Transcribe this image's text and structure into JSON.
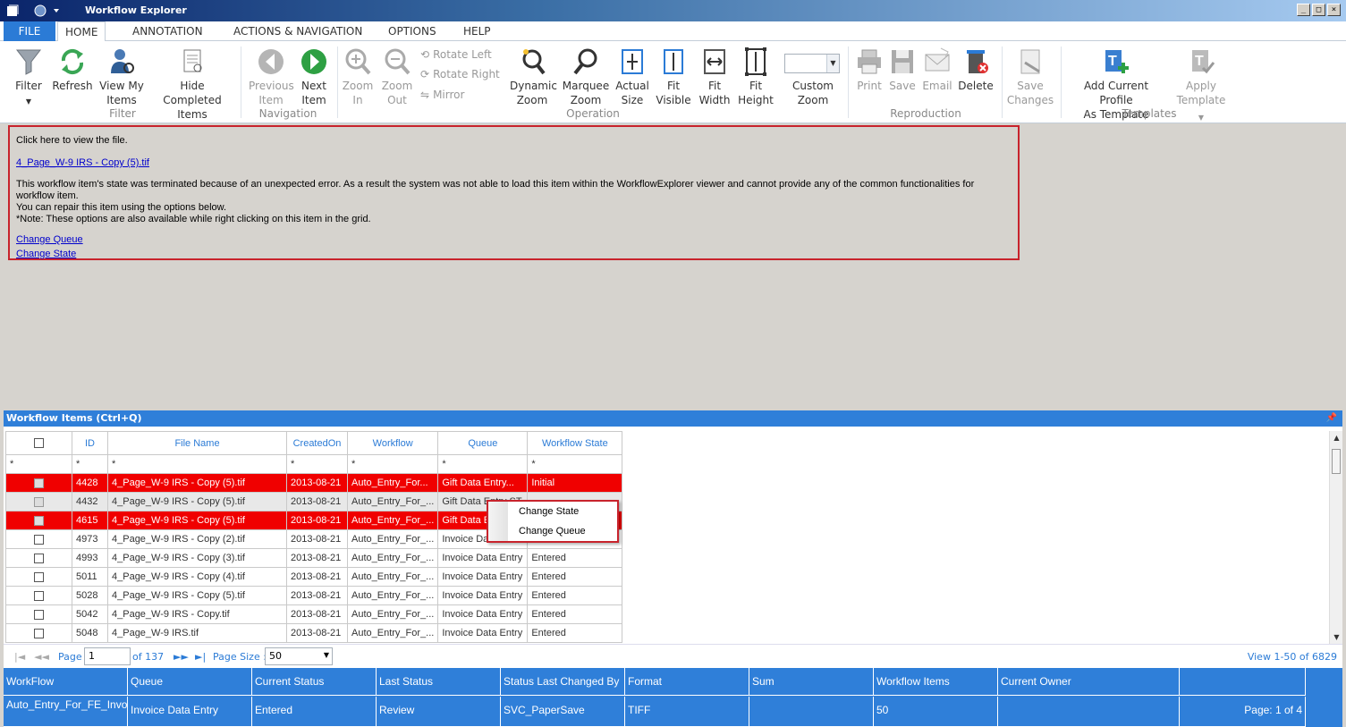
{
  "window": {
    "title": "Workflow Explorer"
  },
  "tabs": [
    "FILE",
    "HOME",
    "ANNOTATION",
    "ACTIONS & NAVIGATION",
    "OPTIONS",
    "HELP"
  ],
  "ribbon": {
    "filter": {
      "filter": "Filter",
      "refresh": "Refresh",
      "view_my_1": "View My",
      "view_my_2": "Items",
      "hide_1": "Hide Completed",
      "hide_2": "Items",
      "label": "Filter"
    },
    "navigation": {
      "prev_1": "Previous",
      "prev_2": "Item",
      "next_1": "Next",
      "next_2": "Item",
      "label": "Navigation"
    },
    "operation": {
      "zoom_in_1": "Zoom",
      "zoom_in_2": "In",
      "zoom_out_1": "Zoom",
      "zoom_out_2": "Out",
      "rotate_left": "Rotate Left",
      "rotate_right": "Rotate Right",
      "mirror": "Mirror",
      "dynamic_1": "Dynamic",
      "dynamic_2": "Zoom",
      "marquee_1": "Marquee",
      "marquee_2": "Zoom",
      "actual_1": "Actual",
      "actual_2": "Size",
      "fitv_1": "Fit",
      "fitv_2": "Visible",
      "fitw_1": "Fit",
      "fitw_2": "Width",
      "fith_1": "Fit",
      "fith_2": "Height",
      "custom_1": "Custom",
      "custom_2": "Zoom",
      "label": "Operation"
    },
    "reproduction": {
      "print": "Print",
      "save": "Save",
      "email": "Email",
      "delete": "Delete",
      "label": "Reproduction"
    },
    "changes": {
      "save_1": "Save",
      "save_2": "Changes"
    },
    "templates": {
      "add_1": "Add Current Profile",
      "add_2": "As Template",
      "apply_1": "Apply",
      "apply_2": "Template",
      "label": "Templates"
    }
  },
  "error": {
    "click_here": "Click here to view the file.",
    "file_link": "4_Page_W-9 IRS - Copy (5).tif",
    "line1": "This workflow item's state was terminated because of an unexpected error.   As a result the system was not able to load this item within the WorkflowExplorer viewer and cannot  provide any of the common functionalities for workflow item.",
    "line2": "You can repair this item using the options below.",
    "line3": "*Note: These options are also available while right clicking on this item in the grid.",
    "change_queue": "Change Queue",
    "change_state": "Change State"
  },
  "grid": {
    "title": "Workflow Items (Ctrl+Q)",
    "columns": [
      "ID",
      "File Name",
      "CreatedOn",
      "Workflow",
      "Queue",
      "Workflow State"
    ],
    "filter_symbol": "*",
    "rows": [
      {
        "id": "4428",
        "file": "4_Page_W-9 IRS - Copy (5).tif",
        "created": "2013-08-21",
        "workflow": "Auto_Entry_For...",
        "queue": "Gift Data Entry...",
        "state": "Initial"
      },
      {
        "id": "4432",
        "file": "4_Page_W-9 IRS - Copy (5).tif",
        "created": "2013-08-21",
        "workflow": "Auto_Entry_For_...",
        "queue": "Gift Data Entry ST",
        "state": ""
      },
      {
        "id": "4615",
        "file": "4_Page_W-9 IRS - Copy (5).tif",
        "created": "2013-08-21",
        "workflow": "Auto_Entry_For_...",
        "queue": "Gift Data E",
        "state": ""
      },
      {
        "id": "4973",
        "file": "4_Page_W-9 IRS - Copy (2).tif",
        "created": "2013-08-21",
        "workflow": "Auto_Entry_For_...",
        "queue": "Invoice Da",
        "state": ""
      },
      {
        "id": "4993",
        "file": "4_Page_W-9 IRS - Copy (3).tif",
        "created": "2013-08-21",
        "workflow": "Auto_Entry_For_...",
        "queue": "Invoice Data Entry",
        "state": "Entered"
      },
      {
        "id": "5011",
        "file": "4_Page_W-9 IRS - Copy (4).tif",
        "created": "2013-08-21",
        "workflow": "Auto_Entry_For_...",
        "queue": "Invoice Data Entry",
        "state": "Entered"
      },
      {
        "id": "5028",
        "file": "4_Page_W-9 IRS - Copy (5).tif",
        "created": "2013-08-21",
        "workflow": "Auto_Entry_For_...",
        "queue": "Invoice Data Entry",
        "state": "Entered"
      },
      {
        "id": "5042",
        "file": "4_Page_W-9 IRS - Copy.tif",
        "created": "2013-08-21",
        "workflow": "Auto_Entry_For_...",
        "queue": "Invoice Data Entry",
        "state": "Entered"
      },
      {
        "id": "5048",
        "file": "4_Page_W-9 IRS.tif",
        "created": "2013-08-21",
        "workflow": "Auto_Entry_For_...",
        "queue": "Invoice Data Entry",
        "state": "Entered"
      }
    ]
  },
  "context_menu": {
    "change_state": "Change State",
    "change_queue": "Change Queue"
  },
  "pager": {
    "page_label": "Page",
    "page_value": "1",
    "of_label": "of 137",
    "page_size_label": "Page Size :",
    "page_size_value": "50",
    "view_label": "View 1-50 of 6829"
  },
  "summary": {
    "headers": [
      "WorkFlow",
      "Queue",
      "Current Status",
      "Last Status",
      "Status Last Changed By",
      "Format",
      "Sum",
      "Workflow Items",
      "Current Owner",
      ""
    ],
    "values": [
      "Auto_Entry_For_FE_Invoice",
      "Invoice Data Entry",
      "Entered",
      "Review",
      "SVC_PaperSave",
      "TIFF",
      "",
      "50",
      "",
      "Page: 1 of 4"
    ]
  },
  "colors": {
    "accent": "#2f7fd9",
    "error_red": "#f00000",
    "border_red": "#c8232c"
  }
}
